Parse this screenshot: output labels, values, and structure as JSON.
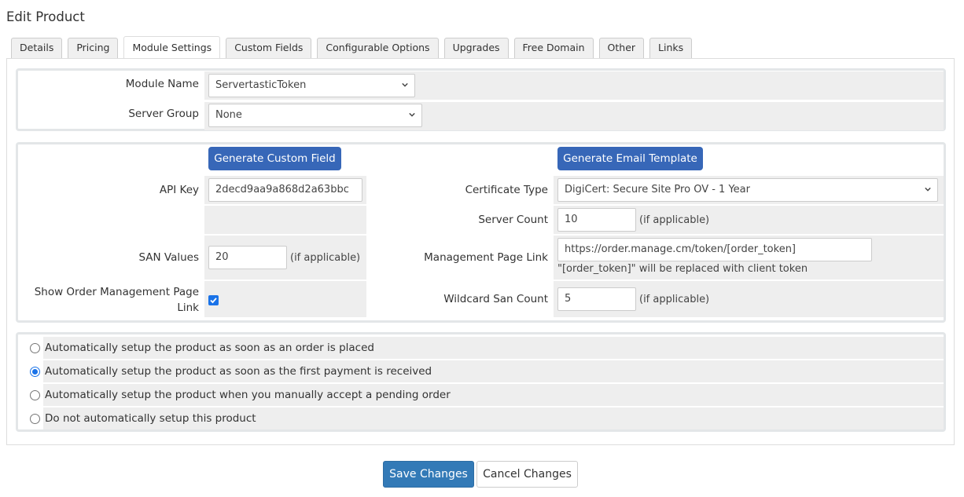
{
  "page": {
    "title": "Edit Product"
  },
  "tabs": [
    {
      "label": "Details",
      "active": false
    },
    {
      "label": "Pricing",
      "active": false
    },
    {
      "label": "Module Settings",
      "active": true
    },
    {
      "label": "Custom Fields",
      "active": false
    },
    {
      "label": "Configurable Options",
      "active": false
    },
    {
      "label": "Upgrades",
      "active": false
    },
    {
      "label": "Free Domain",
      "active": false
    },
    {
      "label": "Other",
      "active": false
    },
    {
      "label": "Links",
      "active": false
    }
  ],
  "module": {
    "module_name_label": "Module Name",
    "module_name_value": "ServertasticToken",
    "server_group_label": "Server Group",
    "server_group_value": "None"
  },
  "config": {
    "generate_custom_field_label": "Generate Custom Field",
    "generate_email_template_label": "Generate Email Template",
    "api_key_label": "API Key",
    "api_key_value": "2decd9aa9a868d2a63bbc",
    "certificate_type_label": "Certificate Type",
    "certificate_type_value": "DigiCert: Secure Site Pro OV - 1 Year",
    "server_count_label": "Server Count",
    "server_count_value": "10",
    "server_count_hint": "(if applicable)",
    "san_values_label": "SAN Values",
    "san_values_value": "20",
    "san_values_hint": "(if applicable)",
    "management_link_label": "Management Page Link",
    "management_link_value": "https://order.manage.cm/token/[order_token]",
    "management_link_help": "\"[order_token]\" will be replaced with client token",
    "show_link_label_line1": "Show Order Management Page",
    "show_link_label_line2": "Link",
    "show_link_checked": true,
    "wildcard_label": "Wildcard San Count",
    "wildcard_value": "5",
    "wildcard_hint": "(if applicable)"
  },
  "setup_options": [
    {
      "label": "Automatically setup the product as soon as an order is placed",
      "checked": false
    },
    {
      "label": "Automatically setup the product as soon as the first payment is received",
      "checked": true
    },
    {
      "label": "Automatically setup the product when you manually accept a pending order",
      "checked": false
    },
    {
      "label": "Do not automatically setup this product",
      "checked": false
    }
  ],
  "footer": {
    "save_label": "Save Changes",
    "cancel_label": "Cancel Changes"
  },
  "colors": {
    "primary": "#3767b8",
    "save": "#337ab7",
    "cell_bg": "#eeeeee"
  }
}
